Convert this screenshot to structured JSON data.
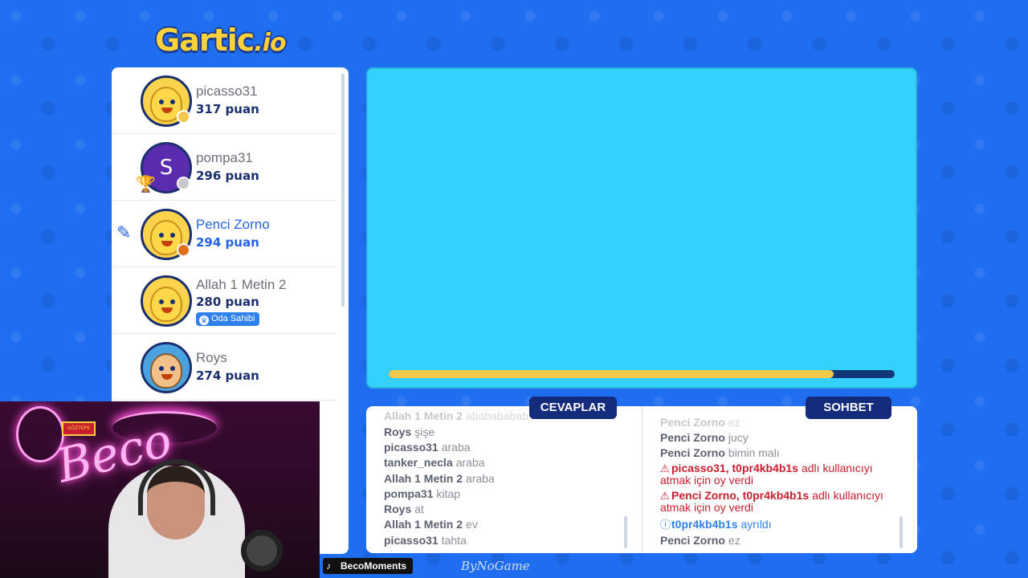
{
  "logo": {
    "text": "Gartic",
    "suffix": ".io"
  },
  "players": [
    {
      "name": "picasso31",
      "score": "317 puan",
      "status_color": "#f2c94c"
    },
    {
      "name": "pompa31",
      "score": "296 puan",
      "avatar_letter": "S",
      "status_color": "#c5c8ce"
    },
    {
      "name": "Penci Zorno",
      "score": "294 puan",
      "status_color": "#e0701c"
    },
    {
      "name": "Allah 1 Metin 2",
      "score": "280 puan",
      "badge": "Oda Sahibi"
    },
    {
      "name": "Roys",
      "score": "274 puan"
    }
  ],
  "canvas": {
    "background": "#33d1fc",
    "timer_progress": 0.88
  },
  "tabs": {
    "answers": "CEVAPLAR",
    "chat": "SOHBET"
  },
  "answers": [
    {
      "who": "Allah 1 Metin 2",
      "text": "ababababab",
      "faded": true
    },
    {
      "who": "Roys",
      "text": "şişe"
    },
    {
      "who": "picasso31",
      "text": "araba"
    },
    {
      "who": "tanker_necla",
      "text": "araba"
    },
    {
      "who": "Allah 1 Metin 2",
      "text": "araba"
    },
    {
      "who": "pompa31",
      "text": "kitap"
    },
    {
      "who": "Roys",
      "text": "at"
    },
    {
      "who": "Allah 1 Metin 2",
      "text": "ev"
    },
    {
      "who": "picasso31",
      "text": "tahta"
    }
  ],
  "chat": [
    {
      "who": "Penci Zorno",
      "text": "ez",
      "faded": true
    },
    {
      "who": "Penci Zorno",
      "text": "jucy"
    },
    {
      "who": "Penci Zorno",
      "text": "bimin malı"
    },
    {
      "kind": "warn",
      "who": "picasso31, t0pr4kb4b1s",
      "text": "adlı kullanıcıyı atmak için oy verdi"
    },
    {
      "kind": "warn",
      "who": "Penci Zorno, t0pr4kb4b1s",
      "text": "adlı kullanıcıyı atmak için oy verdi"
    },
    {
      "kind": "info",
      "who": "t0pr4kb4b1s",
      "text": "ayrıldı"
    },
    {
      "who": "Penci Zorno",
      "text": "ez"
    }
  ],
  "webcam": {
    "neon_text": "Beco",
    "sign_text": "GÖZTEPE"
  },
  "overlay": {
    "tag": "BecoMoments",
    "by": "ByNoGame"
  },
  "colors": {
    "accent": "#2563eb",
    "tab_bg": "#142a7a",
    "page_bg": "#1f6ef0",
    "timer_fill": "#f2c94c",
    "timer_track": "#123a7a",
    "warn": "#c81e2e",
    "info": "#2f80ed"
  }
}
